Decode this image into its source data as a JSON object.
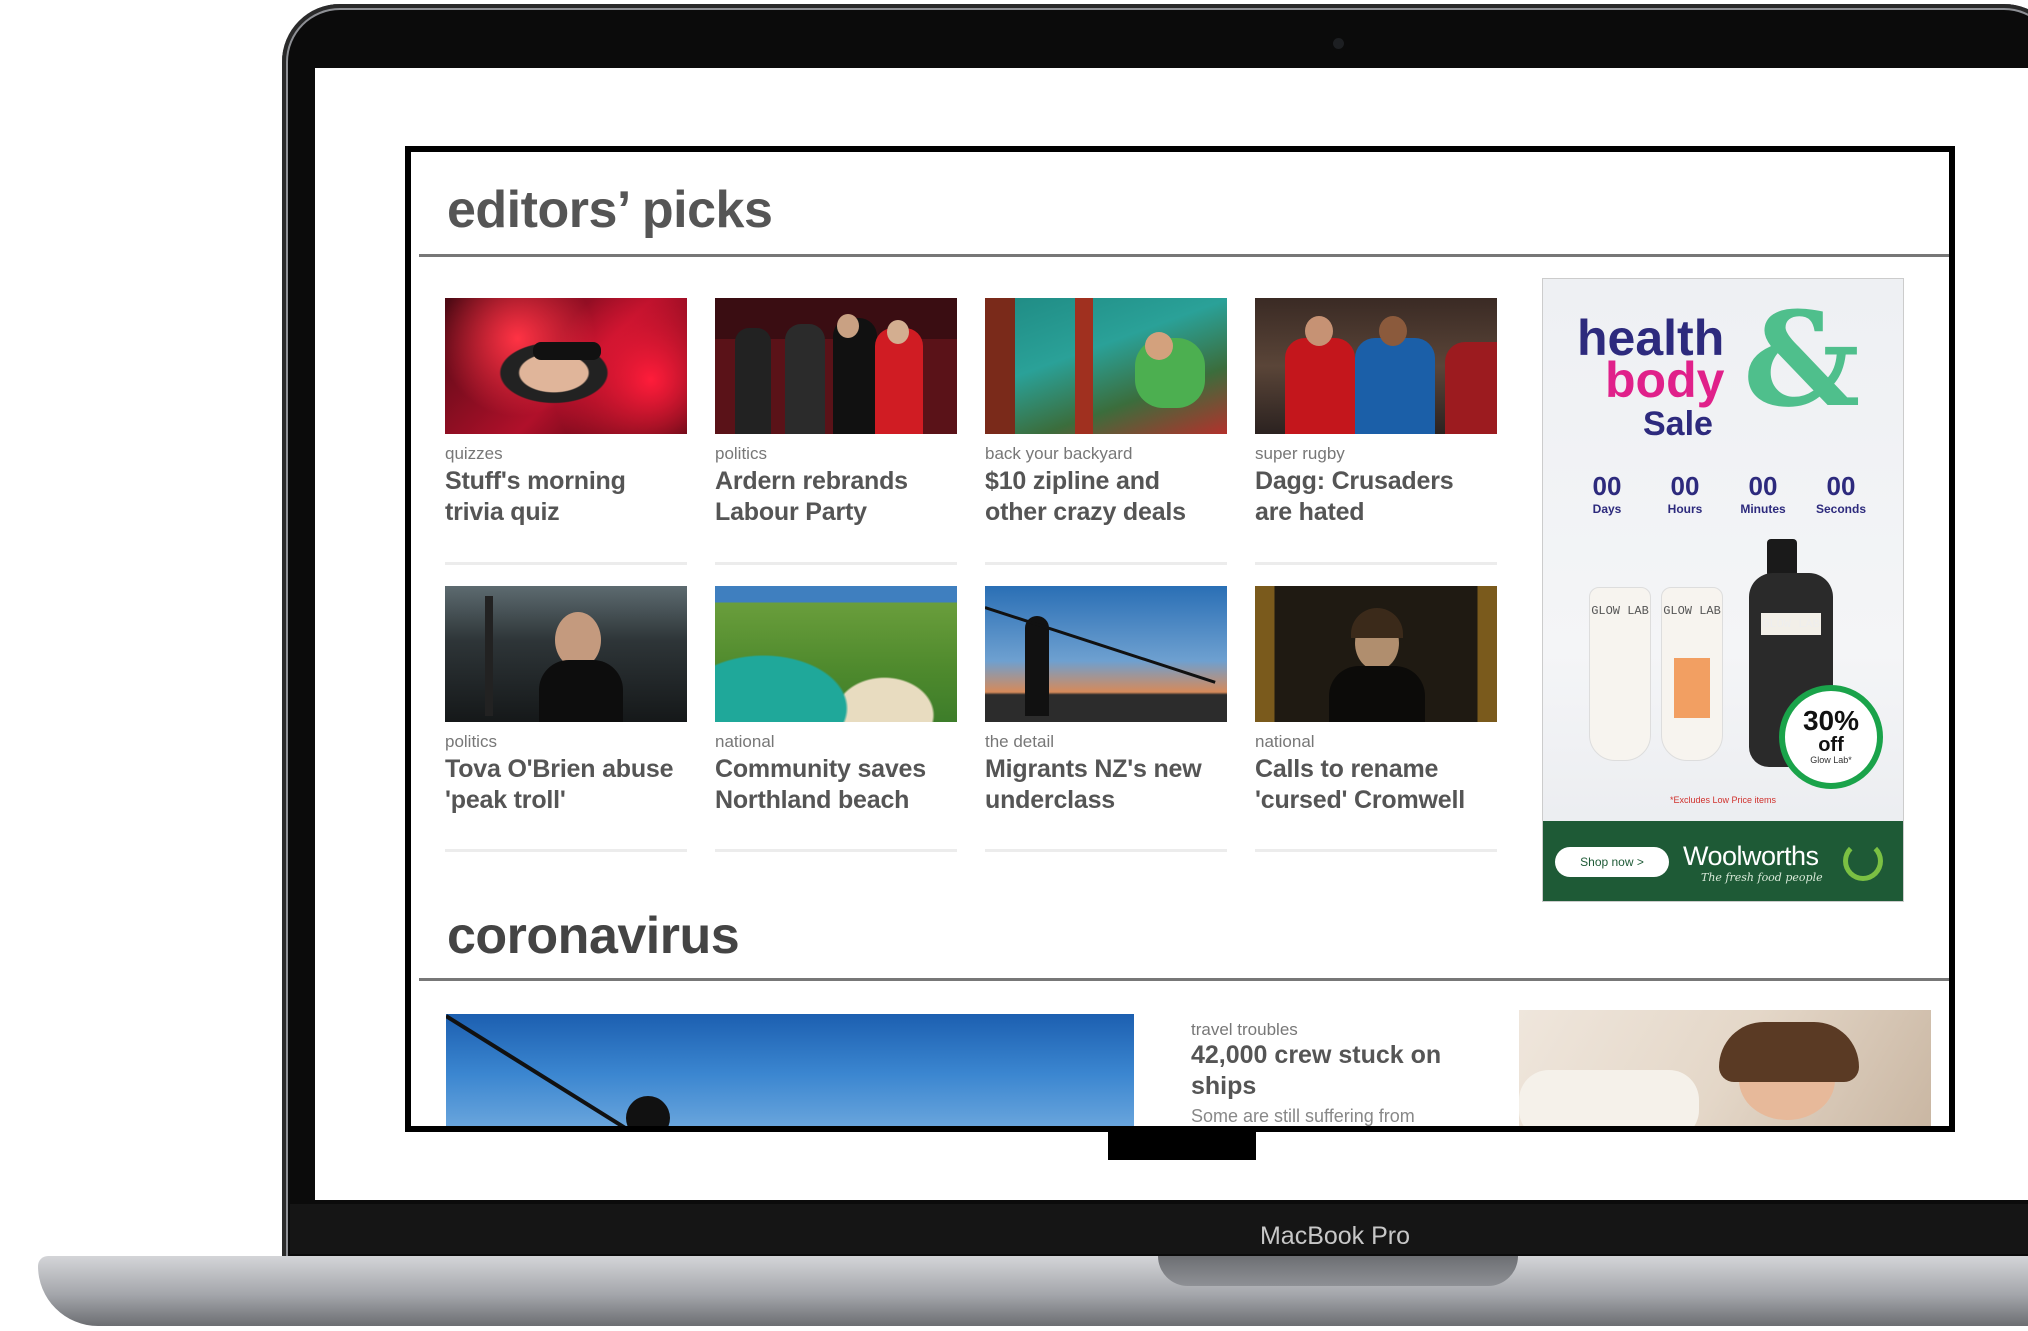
{
  "device": {
    "model_label": "MacBook Pro"
  },
  "editors_picks": {
    "title": "editors’ picks",
    "cards": [
      {
        "tag": "quizzes",
        "headline": "Stuff's morning trivia quiz",
        "image": "woman-sunglasses-red-lights"
      },
      {
        "tag": "politics",
        "headline": "Ardern rebrands Labour Party",
        "image": "politicians-crowd"
      },
      {
        "tag": "back your backyard",
        "headline": "$10 zipline and other crazy deals",
        "image": "zipline-forest"
      },
      {
        "tag": "super rugby",
        "headline": "Dagg: Crusaders are hated",
        "image": "rugby-players"
      },
      {
        "tag": "politics",
        "headline": "Tova O'Brien abuse 'peak troll'",
        "image": "woman-portrait-dark"
      },
      {
        "tag": "national",
        "headline": "Community saves Northland beach",
        "image": "coastline-aerial"
      },
      {
        "tag": "the detail",
        "headline": "Migrants NZ's new underclass",
        "image": "silhouette-sunset"
      },
      {
        "tag": "national",
        "headline": "Calls to rename 'cursed' Cromwell",
        "image": "oliver-cromwell-portrait"
      }
    ]
  },
  "ad": {
    "word1": "health",
    "word2": "body",
    "amp": "&",
    "word3": "Sale",
    "countdown": [
      {
        "value": "00",
        "label": "Days"
      },
      {
        "value": "00",
        "label": "Hours"
      },
      {
        "value": "00",
        "label": "Minutes"
      },
      {
        "value": "00",
        "label": "Seconds"
      }
    ],
    "bottle_brand": "GLOW LAB",
    "discount_pct": "30%",
    "discount_off": "off",
    "discount_sub": "Glow Lab*",
    "fine_print_1": "*Excludes Low Price items",
    "shop_button": "Shop now >",
    "brand": "Woolworths",
    "brand_tagline": "The fresh food people",
    "colors": {
      "purple": "#2d2a7d",
      "pink": "#e0218a",
      "green": "#4fbf8c",
      "footer": "#1e5a36"
    }
  },
  "coronavirus": {
    "title": "coronavirus",
    "story": {
      "tag": "travel troubles",
      "headline": "42,000 crew stuck on ships",
      "snippet": "Some are still suffering from"
    }
  }
}
